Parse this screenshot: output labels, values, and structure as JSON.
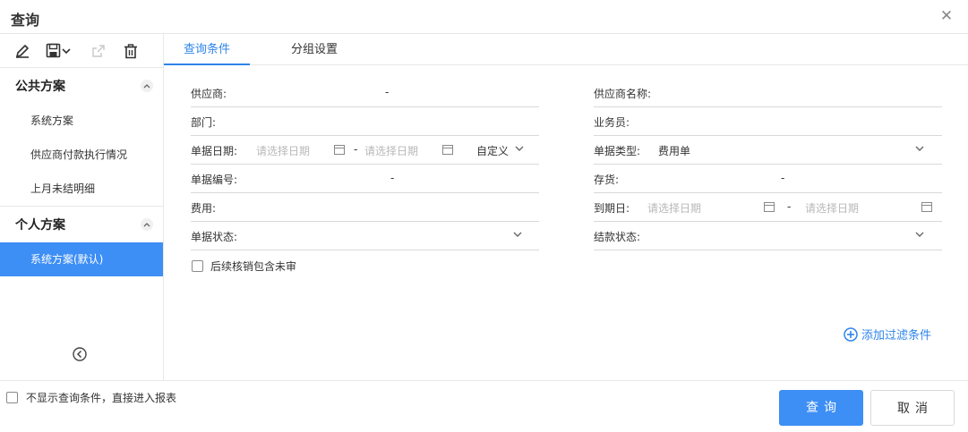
{
  "dialog": {
    "title": "查询"
  },
  "icons": {
    "close": "close-icon",
    "edit": "edit-icon",
    "save": "save-icon",
    "export": "export-icon",
    "delete": "trash-icon",
    "collapse": "chevron-left-circle-icon",
    "calendar": "calendar-icon",
    "dropdown": "chevron-down-icon",
    "add": "plus-circle-icon"
  },
  "sidebar": {
    "public_group": {
      "title": "公共方案",
      "items": [
        "系统方案",
        "供应商付款执行情况",
        "上月未结明细"
      ]
    },
    "personal_group": {
      "title": "个人方案",
      "items": [
        "系统方案(默认)"
      ]
    }
  },
  "tabs": [
    "查询条件",
    "分组设置"
  ],
  "form": {
    "supplier": {
      "label": "供应商:",
      "separator": "-"
    },
    "supplier_name": {
      "label": "供应商名称:"
    },
    "department": {
      "label": "部门:"
    },
    "salesperson": {
      "label": "业务员:"
    },
    "doc_date": {
      "label": "单据日期:",
      "from_placeholder": "请选择日期",
      "separator": "-",
      "to_placeholder": "请选择日期",
      "range_mode": "自定义"
    },
    "doc_type": {
      "label": "单据类型:",
      "value": "费用单"
    },
    "doc_number": {
      "label": "单据编号:",
      "separator": "-"
    },
    "inventory": {
      "label": "存货:",
      "separator": "-"
    },
    "expense": {
      "label": "费用:"
    },
    "due_date": {
      "label": "到期日:",
      "from_placeholder": "请选择日期",
      "separator": "-",
      "to_placeholder": "请选择日期"
    },
    "doc_status": {
      "label": "单据状态:"
    },
    "settle_status": {
      "label": "结款状态:"
    },
    "include_unaudited": {
      "label": "后续核销包含未审",
      "checked": false
    }
  },
  "add_filter_label": "添加过滤条件",
  "footer": {
    "skip_conditions_label": "不显示查询条件，直接进入报表",
    "skip_conditions_checked": false,
    "query_button": "查询",
    "cancel_button": "取消"
  },
  "colors": {
    "accent": "#3d8ef5",
    "tab_active": "#2f84ea",
    "border": "#e8e8e8"
  }
}
